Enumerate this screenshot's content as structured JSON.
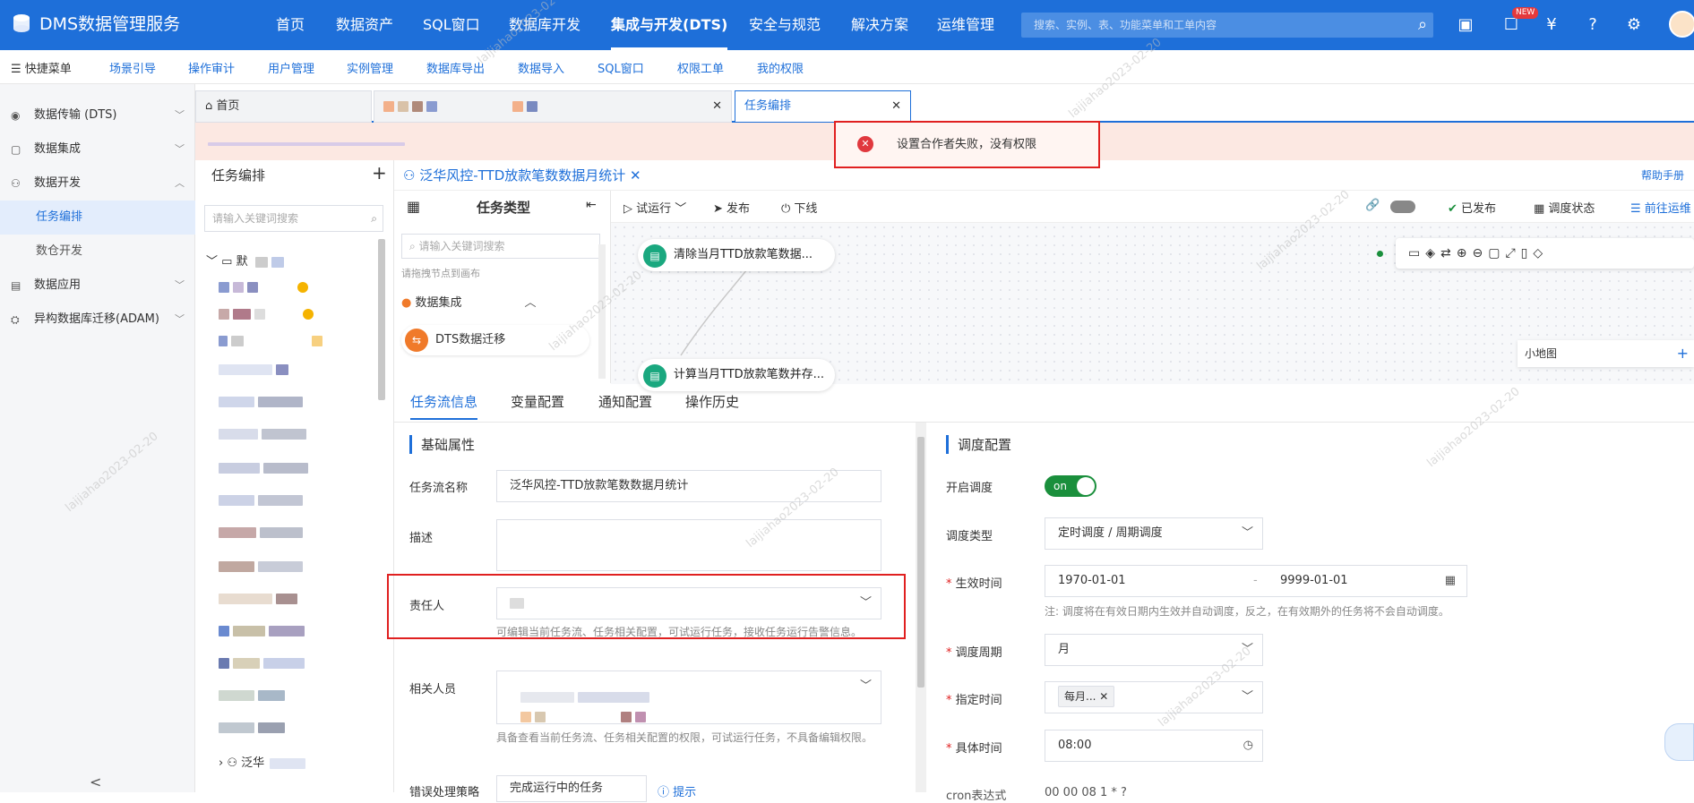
{
  "topbar": {
    "brand": "DMS数据管理服务",
    "nav": [
      "首页",
      "数据资产",
      "SQL窗口",
      "数据库开发",
      "集成与开发(DTS)",
      "安全与规范",
      "解决方案",
      "运维管理"
    ],
    "active_nav": "集成与开发(DTS)",
    "search_placeholder": "搜索、实例、表、功能菜单和工单内容",
    "new_badge": "NEW"
  },
  "quickbar": {
    "menu_label": "快捷菜单",
    "items": [
      "场景引导",
      "操作审计",
      "用户管理",
      "实例管理",
      "数据库导出",
      "数据导入",
      "SQL窗口",
      "权限工单",
      "我的权限"
    ]
  },
  "leftnav": {
    "items": [
      {
        "label": "数据传输 (DTS)",
        "icon": "transfer-icon"
      },
      {
        "label": "数据集成",
        "icon": "integration-icon"
      },
      {
        "label": "数据开发",
        "icon": "develop-icon"
      },
      {
        "label": "任务编排",
        "icon": ""
      },
      {
        "label": "数仓开发",
        "icon": ""
      },
      {
        "label": "数据应用",
        "icon": "app-icon"
      },
      {
        "label": "异构数据库迁移(ADAM)",
        "icon": "migrate-icon"
      }
    ],
    "collapse": "<"
  },
  "tabs": {
    "home": "首页",
    "active": "任务编排"
  },
  "alert": {
    "message": "设置合作者失败，没有权限"
  },
  "tree": {
    "title": "任务编排",
    "search_placeholder": "请输入关键词搜索",
    "root": "默",
    "last_item": "泛华"
  },
  "task": {
    "title": "泛华风控-TTD放款笔数数据月统计",
    "help": "帮助手册"
  },
  "typepanel": {
    "title": "任务类型",
    "search_placeholder": "请输入关键词搜索",
    "drag_hint": "请拖拽节点到画布",
    "group": "数据集成",
    "item": "DTS数据迁移"
  },
  "canvasbar": {
    "trial_run": "试运行",
    "publish": "发布",
    "offline": "下线",
    "published": "已发布",
    "schedule_status": "调度状态",
    "goto": "前往运维"
  },
  "canvas": {
    "node1": "清除当月TTD放款笔数据...",
    "node2": "计算当月TTD放款笔数并存...",
    "minimap": "小地图"
  },
  "detail_tabs": [
    "任务流信息",
    "变量配置",
    "通知配置",
    "操作历史"
  ],
  "basic": {
    "section": "基础属性",
    "name_label": "任务流名称",
    "name_value": "泛华风控-TTD放款笔数数据月统计",
    "desc_label": "描述",
    "owner_label": "责任人",
    "owner_hint": "可编辑当前任务流、任务相关配置，可试运行任务，接收任务运行告警信息。",
    "related_label": "相关人员",
    "related_hint": "具备查看当前任务流、任务相关配置的权限，可试运行任务，不具备编辑权限。",
    "error_policy_label": "错误处理策略",
    "error_policy_value": "完成运行中的任务",
    "tip": "提示"
  },
  "schedule": {
    "section": "调度配置",
    "enable_label": "开启调度",
    "toggle": "on",
    "type_label": "调度类型",
    "type_value": "定时调度 / 周期调度",
    "effective_label": "生效时间",
    "start": "1970-01-01",
    "sep": "-",
    "end": "9999-01-01",
    "note": "注: 调度将在有效日期内生效并自动调度，反之，在有效期外的任务将不会自动调度。",
    "cycle_label": "调度周期",
    "cycle_value": "月",
    "assign_label": "指定时间",
    "assign_tag": "每月...",
    "time_label": "具体时间",
    "time_value": "08:00",
    "cron_label": "cron表达式",
    "cron_value": "00 00 08 1 * ?"
  },
  "watermark": "laijiahao2023-02-20"
}
